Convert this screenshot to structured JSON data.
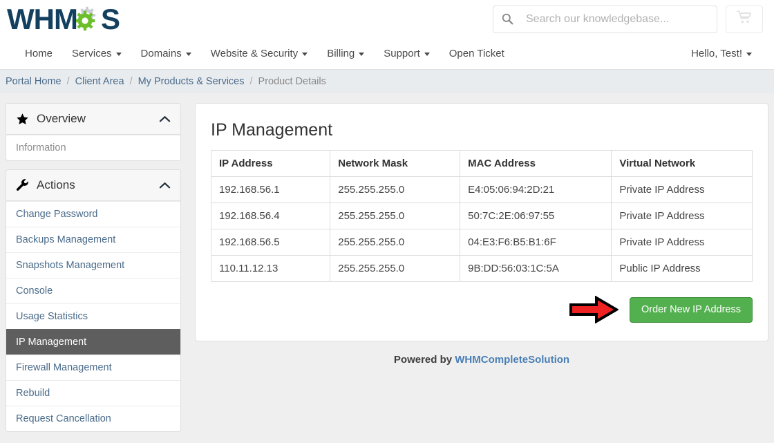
{
  "header": {
    "logo_text_left": "WHM",
    "logo_text_right": "S",
    "logo_alt": "WHMCS",
    "search_placeholder": "Search our knowledgebase...",
    "search_value": "",
    "cart_icon": "shopping-cart-icon",
    "search_icon": "search-icon"
  },
  "nav": {
    "items": [
      {
        "label": "Home",
        "caret": false
      },
      {
        "label": "Services",
        "caret": true
      },
      {
        "label": "Domains",
        "caret": true
      },
      {
        "label": "Website & Security",
        "caret": true
      },
      {
        "label": "Billing",
        "caret": true
      },
      {
        "label": "Support",
        "caret": true
      },
      {
        "label": "Open Ticket",
        "caret": false
      }
    ],
    "account_label": "Hello, Test!"
  },
  "breadcrumb": {
    "items": [
      "Portal Home",
      "Client Area",
      "My Products & Services",
      "Product Details"
    ],
    "separator": "/"
  },
  "sidebar": {
    "panels": [
      {
        "title": "Overview",
        "icon": "star-icon",
        "collapse_icon": "chevron-up-icon",
        "items": [
          {
            "label": "Information",
            "active": false,
            "muted": true
          }
        ]
      },
      {
        "title": "Actions",
        "icon": "wrench-icon",
        "collapse_icon": "chevron-up-icon",
        "items": [
          {
            "label": "Change Password",
            "active": false,
            "muted": false
          },
          {
            "label": "Backups Management",
            "active": false,
            "muted": false
          },
          {
            "label": "Snapshots Management",
            "active": false,
            "muted": false
          },
          {
            "label": "Console",
            "active": false,
            "muted": false
          },
          {
            "label": "Usage Statistics",
            "active": false,
            "muted": false
          },
          {
            "label": "IP Management",
            "active": true,
            "muted": false
          },
          {
            "label": "Firewall Management",
            "active": false,
            "muted": false
          },
          {
            "label": "Rebuild",
            "active": false,
            "muted": false
          },
          {
            "label": "Request Cancellation",
            "active": false,
            "muted": false
          }
        ]
      }
    ]
  },
  "main": {
    "title": "IP Management",
    "table": {
      "headers": [
        "IP Address",
        "Network Mask",
        "MAC Address",
        "Virtual Network"
      ],
      "rows": [
        [
          "192.168.56.1",
          "255.255.255.0",
          "E4:05:06:94:2D:21",
          "Private IP Address"
        ],
        [
          "192.168.56.4",
          "255.255.255.0",
          "50:7C:2E:06:97:55",
          "Private IP Address"
        ],
        [
          "192.168.56.5",
          "255.255.255.0",
          "04:E3:F6:B5:B1:6F",
          "Private IP Address"
        ],
        [
          "110.11.12.13",
          "255.255.255.0",
          "9B:DD:56:03:1C:5A",
          "Public IP Address"
        ]
      ]
    },
    "order_button_label": "Order New IP Address",
    "annotation_arrow": "red-arrow-pointing-right"
  },
  "footer": {
    "prefix": "Powered by ",
    "link_label": "WHMCompleteSolution"
  },
  "colors": {
    "brand_navy": "#13405f",
    "brand_green": "#6cbe2a",
    "button_green": "#53b04f",
    "active_sidebar": "#5e5e5e",
    "link_blue": "#4a6b8a",
    "arrow_red": "#ee2222"
  }
}
